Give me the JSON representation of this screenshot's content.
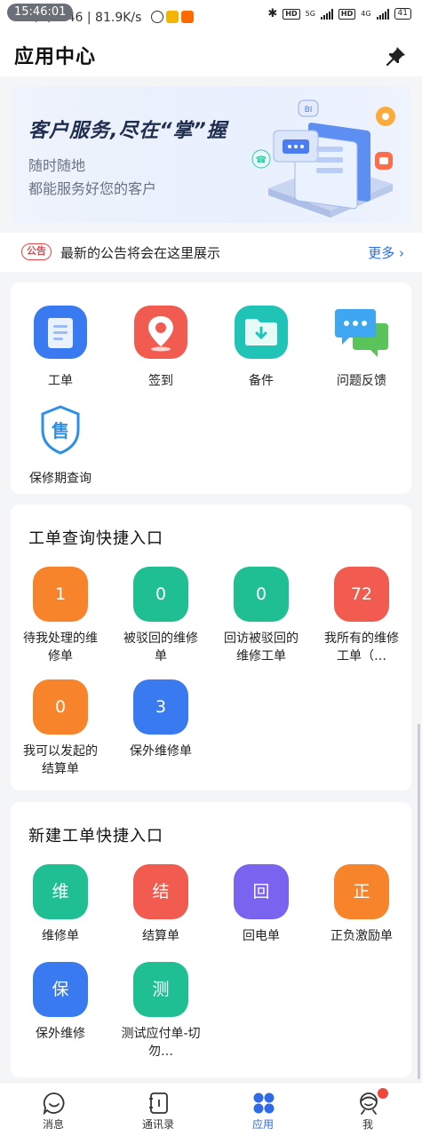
{
  "status_bar": {
    "time": "15:46:01",
    "left_text": "下午5:46 | 81.9K/s",
    "network_labels": [
      "HD",
      "5G",
      "HD",
      "4G"
    ],
    "battery": "41"
  },
  "header": {
    "title": "应用中心"
  },
  "banner": {
    "title": "客户服务,尽在“掌”握",
    "line1": "随时随地",
    "line2": "都能服务好您的客户",
    "art_tag": "BI"
  },
  "notice": {
    "badge": "公告",
    "text": "最新的公告将会在这里展示",
    "more": "更多 ›"
  },
  "apps": {
    "items": [
      {
        "label": "工单",
        "icon": "work-order-icon"
      },
      {
        "label": "签到",
        "icon": "location-pin-icon"
      },
      {
        "label": "备件",
        "icon": "folder-download-icon"
      },
      {
        "label": "问题反馈",
        "icon": "chat-bubbles-icon"
      },
      {
        "label": "保修期查询",
        "icon": "warranty-shield-icon",
        "glyph": "售"
      }
    ]
  },
  "query_section": {
    "title": "工单查询快捷入口",
    "items": [
      {
        "value": "1",
        "label": "待我处理的维修单",
        "color": "#f7832a"
      },
      {
        "value": "0",
        "label": "被驳回的维修单",
        "color": "#1fbf93"
      },
      {
        "value": "0",
        "label": "回访被驳回的维修工单",
        "color": "#1fbf93"
      },
      {
        "value": "72",
        "label": "我所有的维修工单（…",
        "color": "#f25b4f"
      },
      {
        "value": "0",
        "label": "我可以发起的结算单",
        "color": "#f7832a"
      },
      {
        "value": "3",
        "label": "保外维修单",
        "color": "#3a7af0"
      }
    ]
  },
  "create_section": {
    "title": "新建工单快捷入口",
    "items": [
      {
        "glyph": "维",
        "label": "维修单",
        "color": "#1fbf93"
      },
      {
        "glyph": "结",
        "label": "结算单",
        "color": "#f25b4f"
      },
      {
        "glyph": "回",
        "label": "回电单",
        "color": "#7a63ee"
      },
      {
        "glyph": "正",
        "label": "正负激励单",
        "color": "#f7832a"
      },
      {
        "glyph": "保",
        "label": "保外维修",
        "color": "#3a7af0"
      },
      {
        "glyph": "测",
        "label": "测试应付单-切勿…",
        "color": "#1fbf93"
      }
    ]
  },
  "bottom_nav": {
    "items": [
      {
        "label": "消息",
        "icon": "message-smile-icon"
      },
      {
        "label": "通讯录",
        "icon": "contacts-book-icon"
      },
      {
        "label": "应用",
        "icon": "apps-grid-icon",
        "active": true
      },
      {
        "label": "我",
        "icon": "user-profile-icon"
      }
    ]
  },
  "colors": {
    "accent": "#2f6be6",
    "notice_red": "#e5464b",
    "background": "#f4f5f7"
  }
}
